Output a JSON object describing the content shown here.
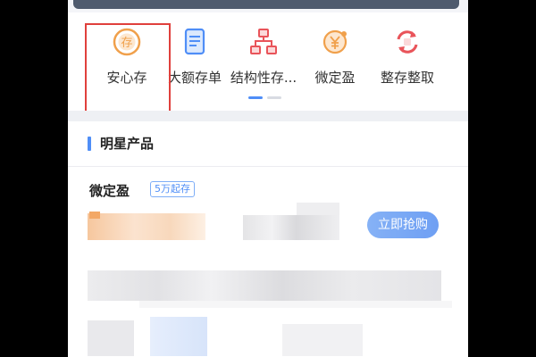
{
  "menu": {
    "items": [
      {
        "label": "安心存",
        "icon": "deposit-coin-icon",
        "icon_text": "存",
        "color": "#f0a04b",
        "selected": true
      },
      {
        "label": "大额存单",
        "icon": "certificate-document-icon",
        "color": "#4f8ef7"
      },
      {
        "label": "结构性存...",
        "icon": "structure-tree-icon",
        "color": "#e9545a"
      },
      {
        "label": "微定盈",
        "icon": "yuan-coin-icon",
        "color": "#f0a04b"
      },
      {
        "label": "整存整取",
        "icon": "exchange-arrows-icon",
        "color": "#e9545a"
      }
    ],
    "page_indicator": {
      "pages": 2,
      "active": 1
    }
  },
  "section": {
    "title": "明星产品",
    "accent": "#4f8ef7"
  },
  "product": {
    "name": "微定盈",
    "min_badge": "5万起存",
    "buy_label": "立即抢购"
  },
  "colors": {
    "selection_outline": "#e0403c",
    "button": "#5f95f2"
  }
}
